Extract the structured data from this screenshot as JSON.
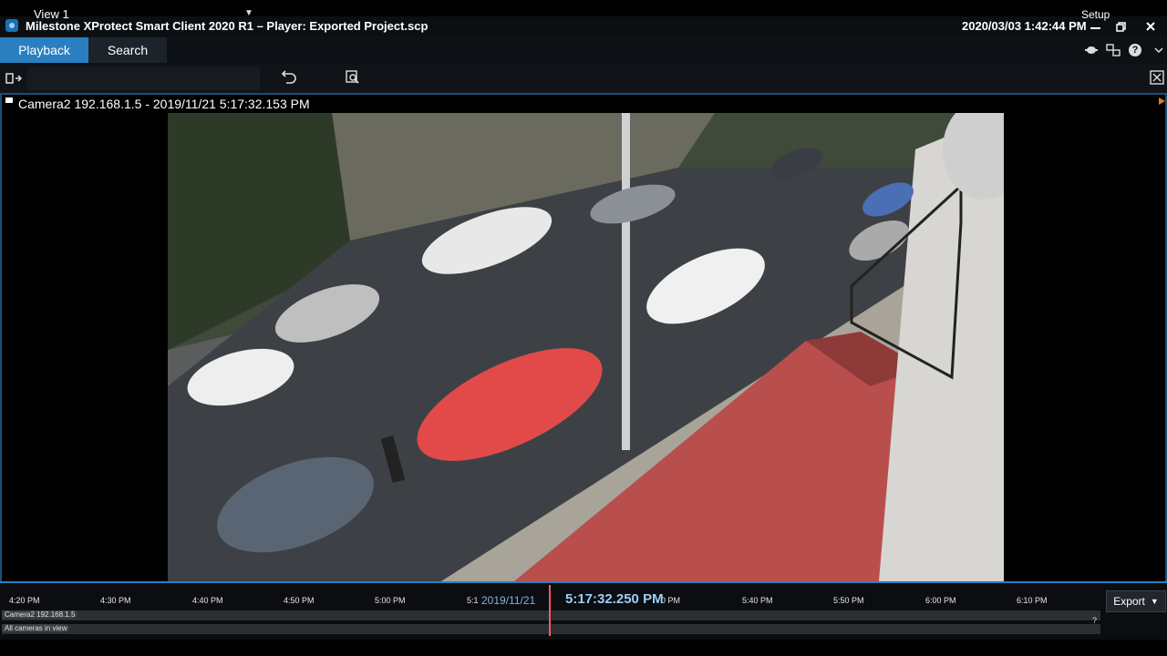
{
  "window": {
    "title": "Milestone XProtect Smart Client 2020 R1 – Player: Exported Project.scp",
    "datetime": "2020/03/03 1:42:44 PM"
  },
  "tabs": [
    {
      "label": "Playback",
      "active": true
    },
    {
      "label": "Search",
      "active": false
    }
  ],
  "viewbar": {
    "view_label": "View 1",
    "setup_label": "Setup"
  },
  "camera": {
    "title": "Camera2 192.168.1.5 - 2019/11/21 5:17:32.153 PM"
  },
  "timeline": {
    "ticks": [
      "4:20 PM",
      "4:30 PM",
      "4:40 PM",
      "4:50 PM",
      "5:00 PM",
      "5:1",
      "0 PM",
      "5:40 PM",
      "5:50 PM",
      "6:00 PM",
      "6:10 PM"
    ],
    "date": "2019/11/21",
    "current_time": "5:17:32.250 PM",
    "tracks": [
      {
        "label": "Camera2 192.168.1.5"
      },
      {
        "label": "All cameras in view"
      }
    ],
    "help_glyph": "?",
    "export_label": "Export"
  },
  "colors": {
    "accent": "#2a7fc0",
    "playhead": "#ff5a6a",
    "time_text": "#9ccdf5"
  }
}
